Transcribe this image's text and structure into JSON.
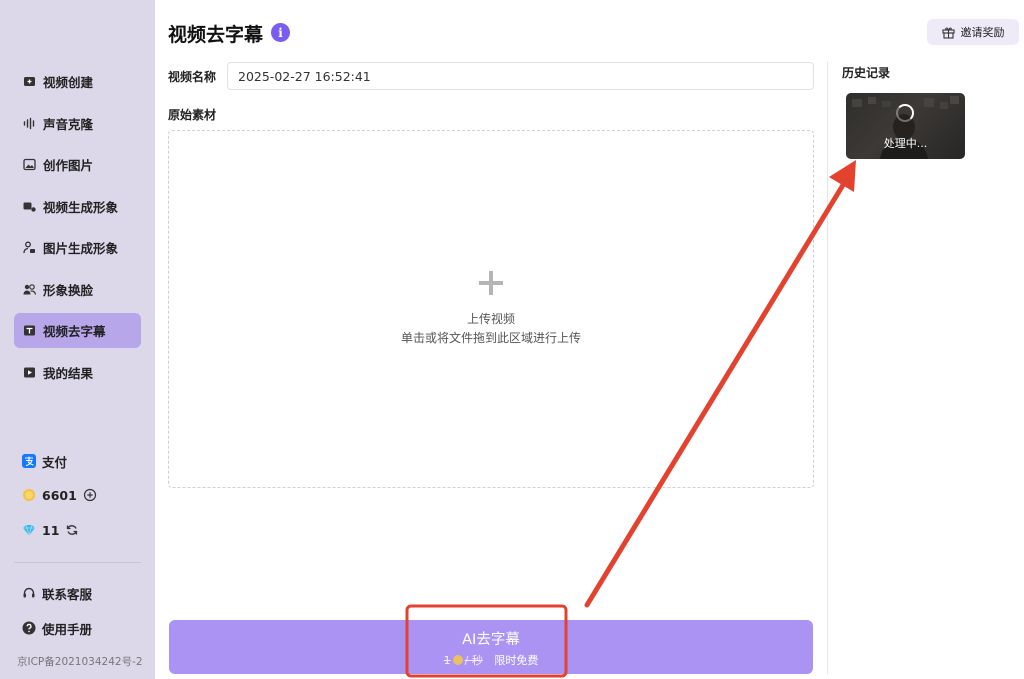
{
  "sidebar": {
    "items": [
      {
        "label": "视频创建",
        "icon": "video-create-icon"
      },
      {
        "label": "声音克隆",
        "icon": "voice-wave-icon"
      },
      {
        "label": "创作图片",
        "icon": "image-icon"
      },
      {
        "label": "视频生成形象",
        "icon": "video-avatar-icon"
      },
      {
        "label": "图片生成形象",
        "icon": "image-avatar-icon"
      },
      {
        "label": "形象换脸",
        "icon": "face-swap-icon"
      },
      {
        "label": "视频去字幕",
        "icon": "subtitle-icon",
        "active": true
      },
      {
        "label": "我的结果",
        "icon": "results-icon"
      }
    ],
    "pay_label": "支付",
    "coin_balance": "6601",
    "gem_balance": "11",
    "service_label": "联系客服",
    "manual_label": "使用手册",
    "icp": "京ICP备2021034242号-2"
  },
  "header": {
    "title": "视频去字幕",
    "info_glyph": "i",
    "invite_label": "邀请奖励"
  },
  "form": {
    "name_label": "视频名称",
    "name_value": "2025-02-27 16:52:41",
    "material_label": "原始素材",
    "upload_title": "上传视频",
    "upload_hint": "单击或将文件拖到此区域进行上传"
  },
  "history": {
    "label": "历史记录",
    "item_status": "处理中..."
  },
  "action": {
    "button_label": "AI去字幕",
    "old_price_num": "1",
    "old_price_unit": "/ 秒",
    "promo": "限时免费"
  },
  "colors": {
    "sidebar_bg": "#dcd8ea",
    "active_item": "#b7a6ea",
    "accent": "#7b5cf0",
    "button": "#ab93f3",
    "annotation_red": "#e3422f"
  }
}
